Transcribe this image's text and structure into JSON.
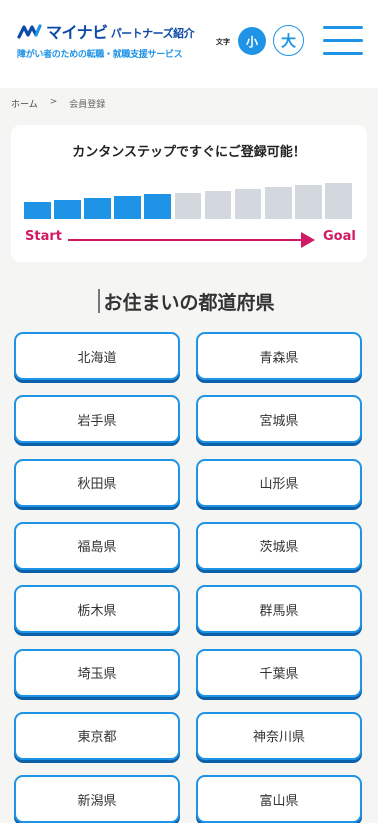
{
  "header": {
    "logo_brand": "マイナビ",
    "logo_sub": "パートナーズ紹介",
    "tagline": "障がい者のための転職・就職支援サービス",
    "font_size_label": "文字",
    "font_small": "小",
    "font_large": "大",
    "menu_icon": "hamburger-menu-icon",
    "accent_color": "#1f93e6",
    "brand_color": "#0b4aa8"
  },
  "breadcrumb": {
    "home": "ホーム",
    "separator": ">",
    "current": "会員登録"
  },
  "steps": {
    "title": "カンタンステップですぐにご登録可能！",
    "start_label": "Start",
    "goal_label": "Goal",
    "total_steps": 11,
    "completed_steps": 5,
    "active_color": "#1f93e6",
    "inactive_color": "#d3d8df",
    "arrow_color": "#d11a63"
  },
  "prefecture_section": {
    "title": "お住まいの都道府県",
    "prefectures": [
      "北海道",
      "青森県",
      "岩手県",
      "宮城県",
      "秋田県",
      "山形県",
      "福島県",
      "茨城県",
      "栃木県",
      "群馬県",
      "埼玉県",
      "千葉県",
      "東京都",
      "神奈川県",
      "新潟県",
      "富山県"
    ]
  }
}
